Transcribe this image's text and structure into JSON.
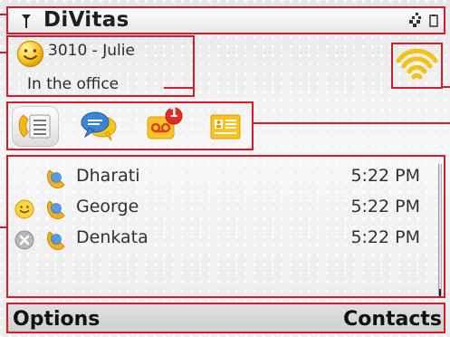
{
  "app": {
    "title": "DiVitas"
  },
  "status_bar": {
    "signal_icon": "signal-icon",
    "network_icon": "network-icon",
    "battery_icon": "battery-icon"
  },
  "user": {
    "name": "3010 - Julie",
    "status": "In the office",
    "presence_icon": "smiley-icon"
  },
  "connection": {
    "icon": "wifi-icon"
  },
  "tabs": [
    {
      "id": "calls",
      "icon": "phone-list-icon",
      "active": true
    },
    {
      "id": "chat",
      "icon": "chat-icon",
      "active": false
    },
    {
      "id": "voicemail",
      "icon": "voicemail-icon",
      "badge": "1",
      "active": false
    },
    {
      "id": "contacts",
      "icon": "contacts-icon",
      "active": false
    }
  ],
  "calls": [
    {
      "name": "Dharati",
      "time": "5:22 PM",
      "status_icon": "",
      "phone_icon": "phone-icon"
    },
    {
      "name": "George",
      "time": "5:22 PM",
      "status_icon": "smiley-icon",
      "phone_icon": "phone-icon"
    },
    {
      "name": "Denkata",
      "time": "5:22 PM",
      "status_icon": "offline-icon",
      "phone_icon": "phone-icon"
    }
  ],
  "softkeys": {
    "left": "Options",
    "right": "Contacts"
  },
  "colors": {
    "annotation": "#d61b2a",
    "accent_yellow": "#f6c31e",
    "chat_blue": "#2f77c6"
  }
}
